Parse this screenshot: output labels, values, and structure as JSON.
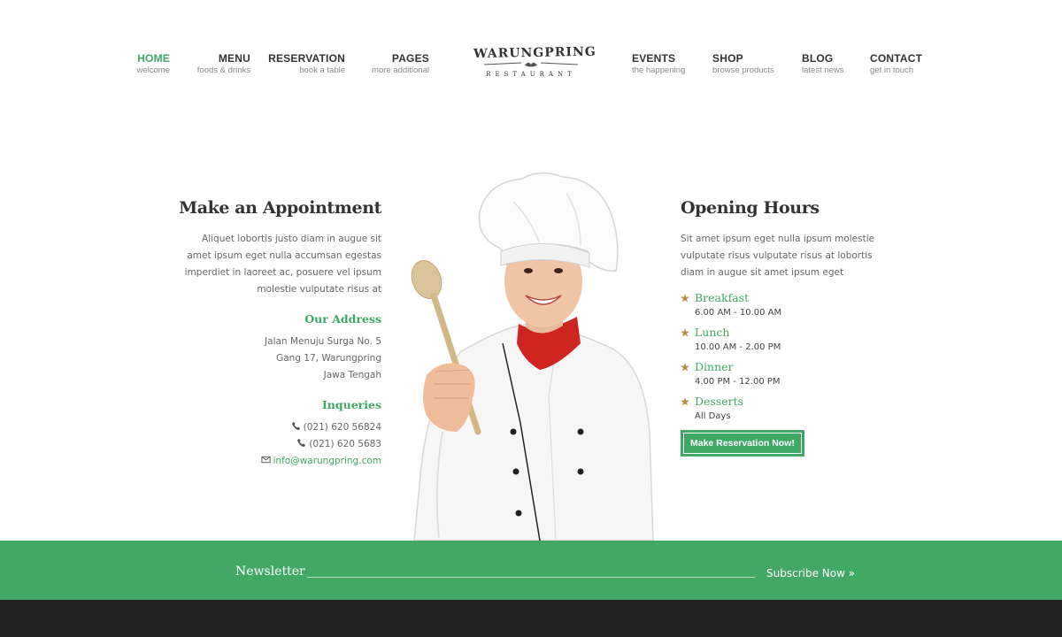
{
  "nav": {
    "left": [
      {
        "title": "HOME",
        "sub": "welcome"
      },
      {
        "title": "MENU",
        "sub": "foods & drinks"
      },
      {
        "title": "RESERVATION",
        "sub": "book a table"
      },
      {
        "title": "PAGES",
        "sub": "more additional"
      }
    ],
    "right": [
      {
        "title": "EVENTS",
        "sub": "the happening"
      },
      {
        "title": "SHOP",
        "sub": "browse products"
      },
      {
        "title": "BLOG",
        "sub": "latest news"
      },
      {
        "title": "CONTACT",
        "sub": "get in touch"
      }
    ],
    "active": "HOME"
  },
  "logo": {
    "name": "WARUNGPRING",
    "sub": "RESTAURANT"
  },
  "appointment": {
    "title": "Make an Appointment",
    "text": "Aliquet lobortis justo diam in augue sit amet ipsum eget nulla accumsan egestas imperdiet in laoreet ac, posuere vel ipsum molestie vulputate risus at",
    "address_title": "Our Address",
    "address": [
      "Jalan Menuju Surga No. 5",
      "Gang 17, Warungpring",
      "Jawa Tengah"
    ],
    "inquiries_title": "Inqueries",
    "phone1": "(021) 620 56824",
    "phone2": "(021) 620 5683",
    "email": "info@warungpring.com"
  },
  "hours": {
    "title": "Opening Hours",
    "text": "Sit amet ipsum eget nulla ipsum molestie vulputate risus vulputate risus at lobortis diam in augue sit amet ipsum eget",
    "meals": [
      {
        "name": "Breakfast",
        "time": "6.00 AM - 10.00 AM"
      },
      {
        "name": "Lunch",
        "time": "10.00 AM - 2.00 PM"
      },
      {
        "name": "Dinner",
        "time": "4.00 PM - 12.00 PM"
      },
      {
        "name": "Desserts",
        "time": "All Days"
      }
    ],
    "button": "Make Reservation Now!"
  },
  "newsletter": {
    "title": "Newsletter",
    "subscribe": "Subscribe Now »"
  },
  "colors": {
    "accent": "#3fa865",
    "dark": "#212121",
    "star": "#b38f4a"
  }
}
